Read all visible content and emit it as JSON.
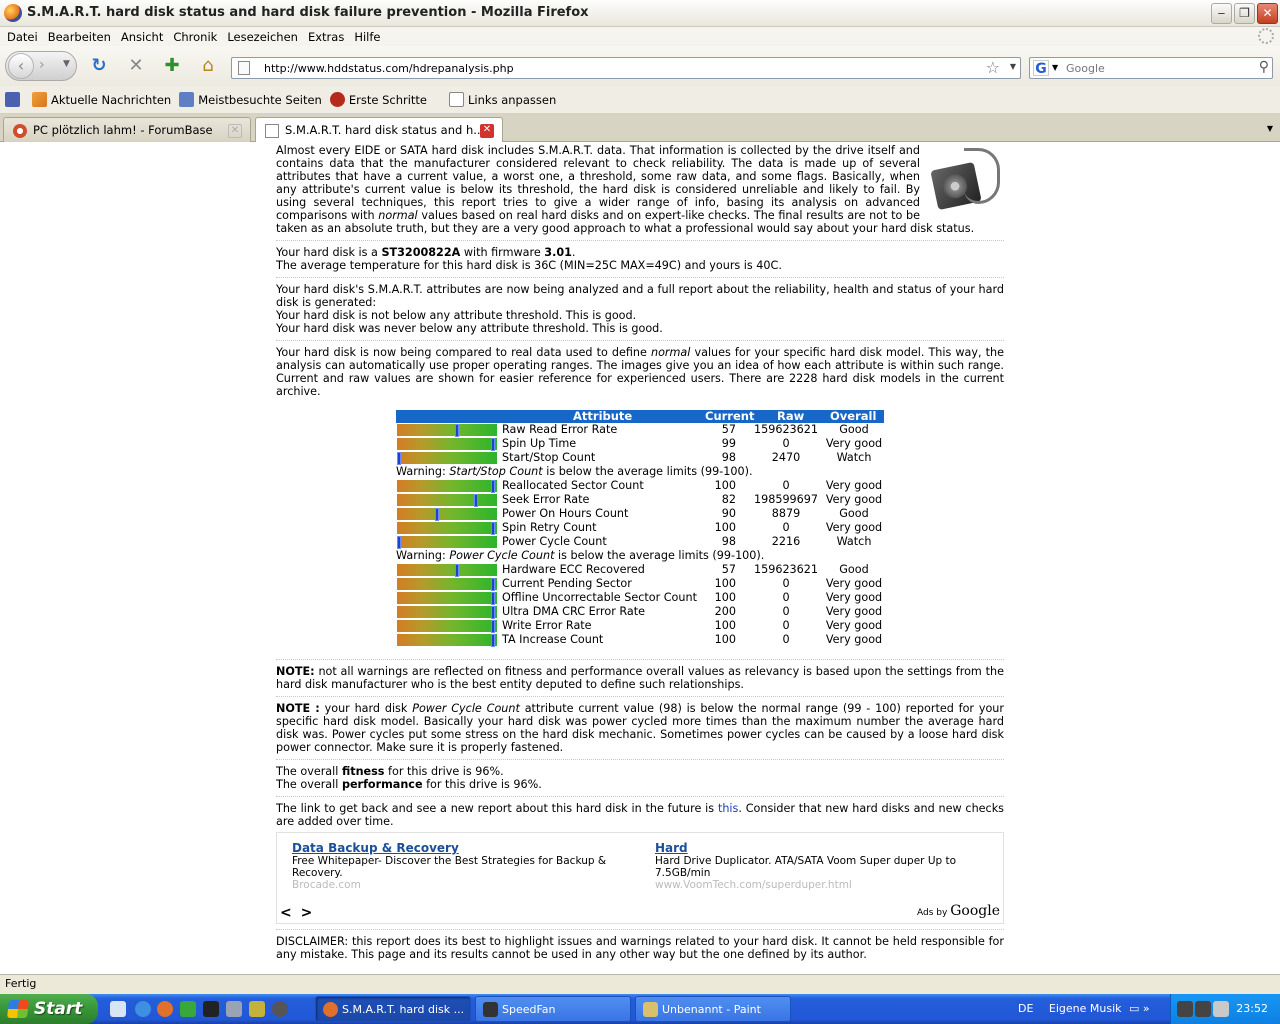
{
  "window": {
    "title": "S.M.A.R.T. hard disk status and hard disk failure prevention - Mozilla Firefox",
    "minimize": "‒",
    "maximize": "❐",
    "close": "✕"
  },
  "menu": [
    "Datei",
    "Bearbeiten",
    "Ansicht",
    "Chronik",
    "Lesezeichen",
    "Extras",
    "Hilfe"
  ],
  "nav": {
    "url": "http://www.hddstatus.com/hdrepanalysis.php",
    "search_placeholder": "Google",
    "search_engine": "G"
  },
  "bookmarks": [
    "Aktuelle Nachrichten",
    "Meistbesuchte Seiten",
    "Erste Schritte",
    "Links anpassen"
  ],
  "tabs": [
    {
      "label": "PC plötzlich lahm! - ForumBase",
      "active": false
    },
    {
      "label": "S.M.A.R.T. hard disk status and h...",
      "active": true
    }
  ],
  "page": {
    "intro": "Almost every EIDE or SATA hard disk includes S.M.A.R.T. data. That information is collected by the drive itself and contains data that the manufacturer considered relevant to check reliability. The data is made up of several attributes that have a current value, a worst one, a threshold, some raw data, and some flags. Basically, when any attribute's current value is below its threshold, the hard disk is considered unreliable and likely to fail. By using several techniques, this report tries to give a wider range of info, basing its analysis on advanced comparisons with",
    "intro_em": "normal",
    "intro_end": "values based on real hard disks and on expert-like checks. The final results are not to be taken as an absolute truth, but they are a very good approach to what a professional would say about your hard disk status.",
    "disk_prefix": "Your hard disk is a",
    "disk_model": "ST3200822A",
    "disk_mid": "with firmware",
    "firmware": "3.01",
    "temperature_line": "The average temperature for this hard disk is 36C (MIN=25C MAX=49C) and yours is 40C.",
    "analysis_line": "Your hard disk's S.M.A.R.T. attributes are now being analyzed and a full report about the reliability, health and status of your hard disk is generated:",
    "threshold_line1": "Your hard disk is not below any attribute threshold. This is good.",
    "threshold_line2": "Your hard disk was never below any attribute threshold. This is good.",
    "compare_a": "Your hard disk is now being compared to real data used to define",
    "compare_em": "normal",
    "compare_b": "values for your specific hard disk model. This way, the analysis can automatically use proper operating ranges. The images give you an idea of how each attribute is within such range. Current and raw values are shown for easier reference for experienced users. There are 2228 hard disk models in the current archive.",
    "note1_label": "NOTE:",
    "note1": "not all warnings are reflected on fitness and performance overall values as relevancy is based upon the settings from the hard disk manufacturer who is the best entity deputed to define such relationships.",
    "note2_label": "NOTE :",
    "note2_a": "your hard disk",
    "note2_em": "Power Cycle Count",
    "note2_b": "attribute current value (98) is below the normal range (99 - 100) reported for your specific hard disk model. Basically your hard disk was power cycled more times than the maximum number the average hard disk was. Power cycles put some stress on the hard disk mechanic. Sometimes power cycles can be caused by a loose hard disk power connector. Make sure it is properly fastened.",
    "fitness_a": "The overall",
    "fitness_b": "fitness",
    "fitness_c": "for this drive is 96%.",
    "perf_a": "The overall",
    "perf_b": "performance",
    "perf_c": "for this drive is 96%.",
    "link_a": "The link to get back and see a new report about this hard disk in the future is",
    "link_text": "this",
    "link_b": ". Consider that new hard disks and new checks are added over time.",
    "disclaimer": "DISCLAIMER: this report does its best to highlight issues and warnings related to your hard disk. It cannot be held responsible for any mistake. This page and its results cannot be used in any other way but the one defined by its author."
  },
  "table": {
    "headers": {
      "attribute": "Attribute",
      "current": "Current",
      "raw": "Raw",
      "overall": "Overall"
    },
    "rows": [
      {
        "name": "Raw Read Error Rate",
        "current": "57",
        "raw": "159623621",
        "overall": "Good",
        "level": 0.6
      },
      {
        "name": "Spin Up Time",
        "current": "99",
        "raw": "0",
        "overall": "Very good",
        "level": 0.98
      },
      {
        "name": "Start/Stop Count",
        "current": "98",
        "raw": "2470",
        "overall": "Watch",
        "level": 0.0,
        "warning_a": "Warning: ",
        "warning_em": "Start/Stop Count",
        "warning_b": " is below the average limits (99-100)."
      },
      {
        "name": "Reallocated Sector Count",
        "current": "100",
        "raw": "0",
        "overall": "Very good",
        "level": 0.98
      },
      {
        "name": "Seek Error Rate",
        "current": "82",
        "raw": "198599697",
        "overall": "Very good",
        "level": 0.8
      },
      {
        "name": "Power On Hours Count",
        "current": "90",
        "raw": "8879",
        "overall": "Good",
        "level": 0.4
      },
      {
        "name": "Spin Retry Count",
        "current": "100",
        "raw": "0",
        "overall": "Very good",
        "level": 0.98
      },
      {
        "name": "Power Cycle Count",
        "current": "98",
        "raw": "2216",
        "overall": "Watch",
        "level": 0.0,
        "warning_a": "Warning: ",
        "warning_em": "Power Cycle Count",
        "warning_b": " is below the average limits (99-100)."
      },
      {
        "name": "Hardware ECC Recovered",
        "current": "57",
        "raw": "159623621",
        "overall": "Good",
        "level": 0.6
      },
      {
        "name": "Current Pending Sector",
        "current": "100",
        "raw": "0",
        "overall": "Very good",
        "level": 0.98
      },
      {
        "name": "Offline Uncorrectable Sector Count",
        "current": "100",
        "raw": "0",
        "overall": "Very good",
        "level": 0.98
      },
      {
        "name": "Ultra DMA CRC Error Rate",
        "current": "200",
        "raw": "0",
        "overall": "Very good",
        "level": 0.98
      },
      {
        "name": "Write Error Rate",
        "current": "100",
        "raw": "0",
        "overall": "Very good",
        "level": 0.98
      },
      {
        "name": "TA Increase Count",
        "current": "100",
        "raw": "0",
        "overall": "Very good",
        "level": 0.98
      }
    ]
  },
  "ads": [
    {
      "title": "Data Backup & Recovery",
      "text": "Free Whitepaper- Discover the Best Strategies for Backup & Recovery.",
      "url": "Brocade.com"
    },
    {
      "title": "Hard",
      "text": "Hard Drive Duplicator. ATA/SATA Voom Super duper Up to 7.5GB/min",
      "url": "www.VoomTech.com/superduper.html"
    }
  ],
  "ads_nav": "< >",
  "ads_by": "Ads by",
  "ads_brand": "Google",
  "status": "Fertig",
  "taskbar": {
    "start": "Start",
    "tasks": [
      "S.M.A.R.T. hard disk ...",
      "SpeedFan",
      "Unbenannt - Paint"
    ],
    "lang": "DE",
    "music": "Eigene Musik",
    "clock": "23:52"
  }
}
